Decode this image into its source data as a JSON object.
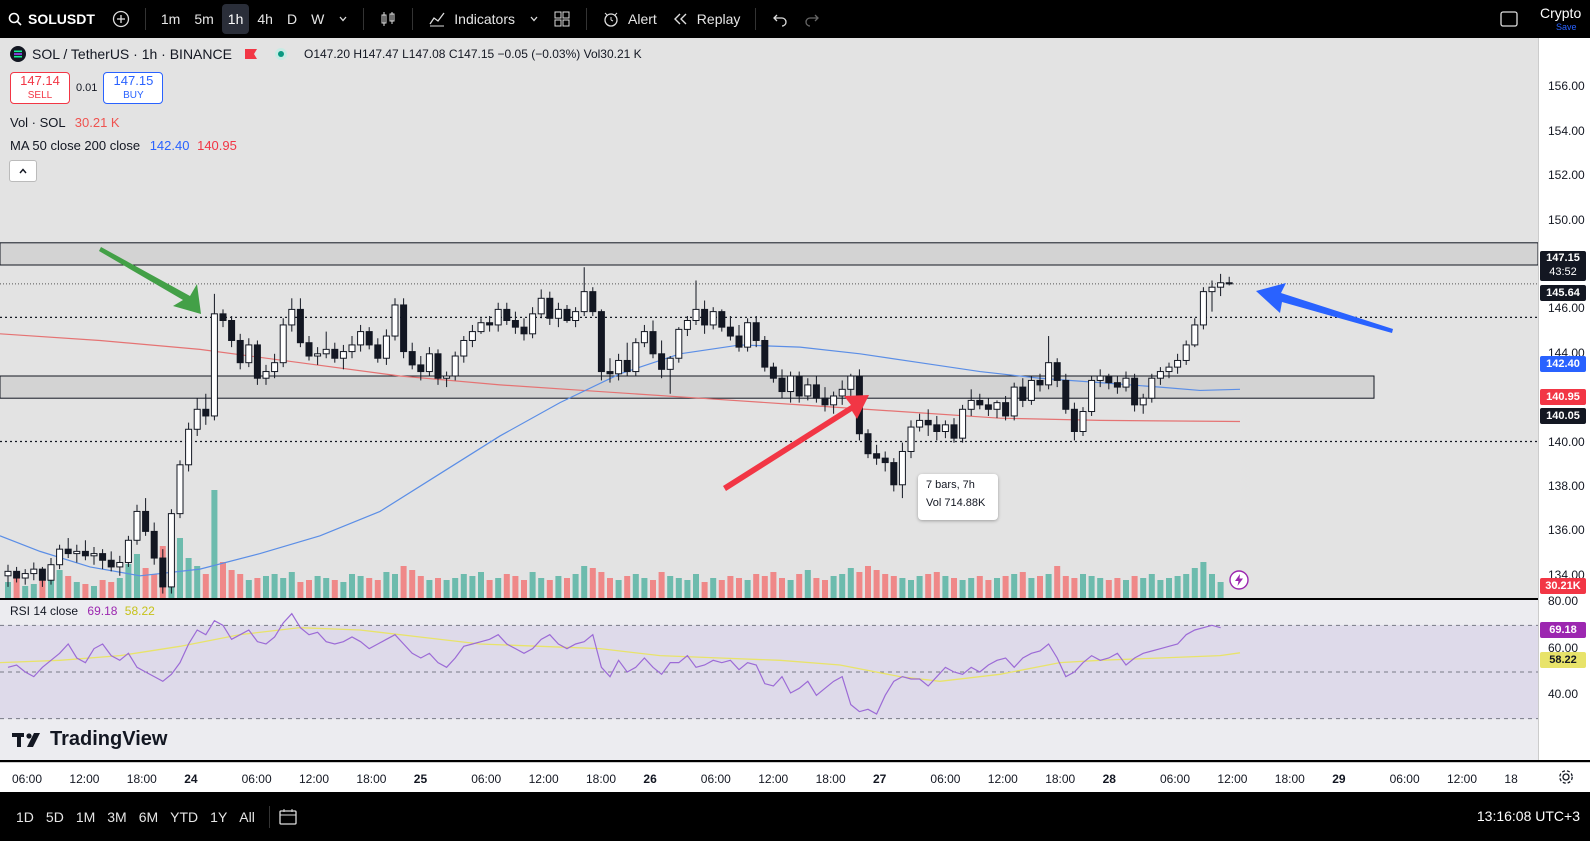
{
  "toolbar": {
    "symbol": "SOLUSDT",
    "intervals": [
      "1m",
      "5m",
      "1h",
      "4h",
      "D",
      "W"
    ],
    "active_interval": "1h",
    "indicators_label": "Indicators",
    "alert_label": "Alert",
    "replay_label": "Replay",
    "crypto_label": "Crypto",
    "save_label": "Save"
  },
  "legend": {
    "title": "SOL / TetherUS · 1h · BINANCE",
    "o_label": "O",
    "o": "147.20",
    "h_label": "H",
    "h": "147.47",
    "l_label": "L",
    "l": "147.08",
    "c_label": "C",
    "c": "147.15",
    "change": "−0.05 (−0.03%)",
    "vol_label": "Vol",
    "vol": "30.21 K"
  },
  "trade": {
    "sell_price": "147.14",
    "sell_label": "SELL",
    "spread": "0.01",
    "buy_price": "147.15",
    "buy_label": "BUY"
  },
  "indicators": {
    "vol_label": "Vol · SOL",
    "vol_value": "30.21 K",
    "ma_label": "MA 50 close 200 close",
    "ma50_value": "142.40",
    "ma200_value": "140.95",
    "collapse_icon": "chevron-up-icon"
  },
  "rsi": {
    "label": "RSI 14 close",
    "value": "69.18",
    "ma_value": "58.22"
  },
  "tooltip": {
    "line1": "7 bars, 7h",
    "line2": "Vol 714.88K"
  },
  "logo": "TradingView",
  "price_tags": {
    "last": "147.15",
    "countdown": "43:52",
    "level1": "145.64",
    "ma50": "142.40",
    "ma200": "140.95",
    "level2": "140.05",
    "volume": "30.21K",
    "rsi": "69.18",
    "rsi_ma": "58.22"
  },
  "bottombar": {
    "ranges": [
      "1D",
      "5D",
      "1M",
      "3M",
      "6M",
      "YTD",
      "1Y",
      "All"
    ],
    "clock": "13:16:08 UTC+3"
  },
  "colors": {
    "up": "#ffffff",
    "down": "#131722",
    "ma50": "#5b8ee6",
    "ma200": "#e57373",
    "rsi": "#9c6bd6",
    "rsi_ma": "#e8e36a",
    "vol_up": "#5fb6a6",
    "vol_down": "#ef7d7d"
  },
  "chart_data": {
    "type": "candlestick",
    "price_axis": {
      "min": 133,
      "max": 157,
      "ticks": [
        "156.00",
        "154.00",
        "152.00",
        "150.00",
        "148.00",
        "146.00",
        "144.00",
        "142.00",
        "140.00",
        "138.00",
        "136.00",
        "134.00"
      ]
    },
    "rsi_axis": {
      "min": 20,
      "max": 80,
      "ticks": [
        "80.00",
        "60.00",
        "40.00"
      ]
    },
    "x_labels": [
      "06:00",
      "12:00",
      "18:00",
      "24",
      "06:00",
      "12:00",
      "18:00",
      "25",
      "06:00",
      "12:00",
      "18:00",
      "26",
      "06:00",
      "12:00",
      "18:00",
      "27",
      "06:00",
      "12:00",
      "18:00",
      "28",
      "06:00",
      "12:00",
      "18:00",
      "29",
      "06:00",
      "12:00",
      "18"
    ],
    "day_labels": [
      "24",
      "25",
      "26",
      "27",
      "28",
      "29"
    ],
    "candles_ohlc": [
      [
        134.0,
        134.5,
        133.5,
        134.2
      ],
      [
        134.2,
        134.4,
        133.7,
        133.9
      ],
      [
        133.9,
        134.3,
        133.6,
        134.1
      ],
      [
        134.1,
        134.6,
        133.8,
        134.3
      ],
      [
        134.3,
        134.4,
        133.5,
        133.8
      ],
      [
        133.8,
        134.8,
        133.6,
        134.5
      ],
      [
        134.5,
        135.4,
        134.3,
        135.2
      ],
      [
        135.2,
        135.7,
        134.8,
        135.0
      ],
      [
        135.0,
        135.4,
        134.6,
        135.1
      ],
      [
        135.1,
        135.6,
        134.7,
        134.9
      ],
      [
        134.9,
        135.3,
        134.5,
        135.0
      ],
      [
        135.0,
        135.2,
        134.3,
        134.7
      ],
      [
        134.7,
        135.1,
        134.2,
        134.4
      ],
      [
        134.4,
        134.9,
        134.0,
        134.6
      ],
      [
        134.6,
        135.8,
        134.4,
        135.6
      ],
      [
        135.6,
        137.2,
        135.4,
        136.9
      ],
      [
        136.9,
        137.5,
        135.8,
        136.0
      ],
      [
        136.0,
        136.4,
        134.5,
        134.8
      ],
      [
        134.8,
        135.2,
        133.2,
        133.5
      ],
      [
        133.5,
        137.0,
        133.2,
        136.8
      ],
      [
        136.8,
        139.2,
        136.6,
        139.0
      ],
      [
        139.0,
        140.9,
        138.7,
        140.6
      ],
      [
        140.6,
        142.0,
        140.3,
        141.5
      ],
      [
        141.5,
        142.2,
        140.8,
        141.2
      ],
      [
        141.2,
        146.7,
        141.0,
        145.8
      ],
      [
        145.8,
        146.0,
        145.2,
        145.5
      ],
      [
        145.5,
        145.7,
        144.3,
        144.6
      ],
      [
        144.6,
        144.9,
        143.3,
        143.6
      ],
      [
        143.6,
        144.7,
        143.4,
        144.4
      ],
      [
        144.4,
        144.6,
        142.6,
        142.9
      ],
      [
        142.9,
        143.5,
        142.6,
        143.2
      ],
      [
        143.2,
        144.0,
        142.9,
        143.6
      ],
      [
        143.6,
        145.6,
        143.4,
        145.3
      ],
      [
        145.3,
        146.5,
        145.0,
        146.0
      ],
      [
        146.0,
        146.5,
        144.3,
        144.5
      ],
      [
        144.5,
        144.8,
        143.7,
        143.9
      ],
      [
        143.9,
        144.3,
        143.5,
        144.0
      ],
      [
        144.0,
        145.0,
        143.8,
        144.2
      ],
      [
        144.2,
        144.5,
        143.6,
        143.8
      ],
      [
        143.8,
        144.4,
        143.3,
        144.1
      ],
      [
        144.1,
        144.8,
        143.8,
        144.4
      ],
      [
        144.4,
        145.3,
        144.1,
        145.0
      ],
      [
        145.0,
        145.2,
        144.2,
        144.4
      ],
      [
        144.4,
        144.7,
        143.6,
        143.8
      ],
      [
        143.8,
        145.1,
        143.5,
        144.8
      ],
      [
        144.8,
        146.5,
        144.6,
        146.2
      ],
      [
        146.2,
        146.5,
        143.8,
        144.1
      ],
      [
        144.1,
        144.5,
        143.3,
        143.5
      ],
      [
        143.5,
        143.9,
        142.8,
        143.2
      ],
      [
        143.2,
        144.3,
        143.0,
        144.0
      ],
      [
        144.0,
        144.2,
        142.6,
        142.9
      ],
      [
        142.9,
        143.2,
        142.5,
        143.0
      ],
      [
        143.0,
        144.1,
        142.8,
        143.9
      ],
      [
        143.9,
        144.8,
        143.6,
        144.6
      ],
      [
        144.6,
        145.3,
        144.3,
        145.0
      ],
      [
        145.0,
        145.6,
        144.9,
        145.4
      ],
      [
        145.4,
        145.7,
        145.0,
        145.3
      ],
      [
        145.3,
        146.3,
        145.0,
        146.0
      ],
      [
        146.0,
        146.3,
        145.3,
        145.5
      ],
      [
        145.5,
        145.9,
        144.9,
        145.2
      ],
      [
        145.2,
        145.6,
        144.6,
        144.9
      ],
      [
        144.9,
        146.1,
        144.7,
        145.8
      ],
      [
        145.8,
        146.9,
        145.6,
        146.5
      ],
      [
        146.5,
        146.8,
        145.3,
        145.6
      ],
      [
        145.6,
        146.3,
        145.2,
        146.0
      ],
      [
        146.0,
        146.2,
        145.4,
        145.5
      ],
      [
        145.5,
        146.1,
        145.2,
        145.9
      ],
      [
        145.9,
        147.9,
        145.7,
        146.8
      ],
      [
        146.8,
        147.0,
        145.7,
        145.9
      ],
      [
        145.9,
        146.0,
        142.8,
        143.2
      ],
      [
        143.2,
        143.8,
        142.7,
        143.1
      ],
      [
        143.1,
        144.0,
        142.8,
        143.7
      ],
      [
        143.7,
        144.5,
        143.0,
        143.2
      ],
      [
        143.2,
        144.7,
        143.0,
        144.5
      ],
      [
        144.5,
        145.3,
        144.3,
        145.0
      ],
      [
        145.0,
        145.5,
        143.8,
        144.0
      ],
      [
        144.0,
        144.6,
        142.9,
        143.3
      ],
      [
        143.3,
        143.9,
        142.2,
        143.8
      ],
      [
        143.8,
        145.2,
        143.6,
        145.1
      ],
      [
        145.1,
        145.7,
        144.8,
        145.5
      ],
      [
        145.5,
        147.3,
        145.3,
        146.0
      ],
      [
        146.0,
        146.4,
        144.9,
        145.3
      ],
      [
        145.3,
        146.1,
        145.1,
        145.9
      ],
      [
        145.9,
        146.0,
        145.0,
        145.2
      ],
      [
        145.2,
        145.7,
        144.6,
        144.8
      ],
      [
        144.8,
        145.3,
        144.1,
        144.3
      ],
      [
        144.3,
        145.6,
        144.1,
        145.4
      ],
      [
        145.4,
        145.7,
        144.3,
        144.6
      ],
      [
        144.6,
        144.8,
        143.2,
        143.4
      ],
      [
        143.4,
        143.6,
        142.7,
        142.9
      ],
      [
        142.9,
        143.3,
        142.0,
        142.3
      ],
      [
        142.3,
        143.2,
        141.8,
        143.0
      ],
      [
        143.0,
        143.2,
        141.8,
        142.1
      ],
      [
        142.1,
        142.9,
        141.9,
        142.6
      ],
      [
        142.6,
        143.0,
        141.8,
        142.0
      ],
      [
        142.0,
        142.5,
        141.4,
        141.7
      ],
      [
        141.7,
        142.3,
        141.3,
        142.1
      ],
      [
        142.1,
        142.8,
        141.7,
        142.4
      ],
      [
        142.4,
        143.1,
        141.9,
        143.0
      ],
      [
        143.0,
        143.3,
        140.1,
        140.4
      ],
      [
        140.4,
        140.6,
        139.3,
        139.5
      ],
      [
        139.5,
        139.9,
        139.0,
        139.3
      ],
      [
        139.3,
        139.6,
        138.7,
        139.1
      ],
      [
        139.1,
        139.3,
        137.8,
        138.1
      ],
      [
        138.1,
        140.0,
        137.5,
        139.6
      ],
      [
        139.6,
        141.0,
        139.3,
        140.7
      ],
      [
        140.7,
        141.3,
        140.5,
        141.0
      ],
      [
        141.0,
        141.5,
        140.3,
        140.8
      ],
      [
        140.8,
        141.2,
        140.1,
        140.5
      ],
      [
        140.5,
        141.0,
        140.2,
        140.8
      ],
      [
        140.8,
        141.1,
        140.0,
        140.2
      ],
      [
        140.2,
        141.7,
        140.0,
        141.5
      ],
      [
        141.5,
        142.4,
        141.2,
        141.9
      ],
      [
        141.9,
        142.2,
        141.5,
        141.7
      ],
      [
        141.7,
        142.0,
        141.2,
        141.5
      ],
      [
        141.5,
        141.9,
        141.1,
        141.8
      ],
      [
        141.8,
        142.1,
        141.0,
        141.2
      ],
      [
        141.2,
        142.7,
        141.0,
        142.5
      ],
      [
        142.5,
        142.9,
        141.6,
        141.9
      ],
      [
        141.9,
        143.0,
        141.7,
        142.8
      ],
      [
        142.8,
        143.1,
        142.3,
        142.6
      ],
      [
        142.6,
        144.8,
        142.4,
        143.6
      ],
      [
        143.6,
        143.8,
        142.5,
        142.8
      ],
      [
        142.8,
        143.1,
        141.3,
        141.5
      ],
      [
        141.5,
        141.8,
        140.1,
        140.5
      ],
      [
        140.5,
        141.6,
        140.3,
        141.4
      ],
      [
        141.4,
        143.0,
        141.2,
        142.8
      ],
      [
        142.8,
        143.3,
        142.5,
        143.0
      ],
      [
        143.0,
        143.1,
        142.4,
        142.7
      ],
      [
        142.7,
        143.0,
        142.2,
        142.5
      ],
      [
        142.5,
        143.2,
        142.3,
        142.9
      ],
      [
        142.9,
        143.1,
        141.4,
        141.7
      ],
      [
        141.7,
        142.2,
        141.3,
        142.0
      ],
      [
        142.0,
        143.1,
        141.8,
        142.9
      ],
      [
        142.9,
        143.4,
        142.6,
        143.2
      ],
      [
        143.2,
        143.6,
        142.9,
        143.4
      ],
      [
        143.4,
        144.0,
        143.1,
        143.7
      ],
      [
        143.7,
        144.6,
        143.5,
        144.4
      ],
      [
        144.4,
        145.6,
        144.3,
        145.3
      ],
      [
        145.3,
        147.0,
        145.1,
        146.8
      ],
      [
        146.8,
        147.3,
        145.9,
        147.0
      ],
      [
        147.0,
        147.6,
        146.6,
        147.2
      ],
      [
        147.2,
        147.47,
        147.08,
        147.15
      ]
    ],
    "volume": [
      8,
      10,
      6,
      7,
      9,
      12,
      14,
      11,
      8,
      7,
      6,
      9,
      8,
      10,
      17,
      22,
      15,
      12,
      26,
      24,
      30,
      20,
      16,
      12,
      54,
      18,
      14,
      12,
      9,
      10,
      11,
      12,
      10,
      13,
      8,
      9,
      11,
      10,
      9,
      8,
      12,
      11,
      10,
      9,
      13,
      12,
      16,
      14,
      11,
      9,
      10,
      9,
      10,
      12,
      11,
      13,
      9,
      10,
      12,
      11,
      9,
      13,
      10,
      9,
      11,
      10,
      12,
      16,
      15,
      13,
      10,
      9,
      11,
      12,
      10,
      9,
      13,
      11,
      10,
      9,
      12,
      8,
      10,
      9,
      11,
      10,
      9,
      12,
      11,
      13,
      10,
      9,
      12,
      14,
      10,
      9,
      11,
      12,
      15,
      13,
      16,
      14,
      12,
      11,
      10,
      9,
      11,
      12,
      13,
      11,
      10,
      9,
      10,
      11,
      9,
      10,
      11,
      12,
      13,
      10,
      11,
      12,
      16,
      11,
      10,
      12,
      11,
      10,
      9,
      10,
      9,
      11,
      10,
      12,
      9,
      10,
      11,
      12,
      15,
      18,
      12,
      8
    ],
    "ma50": [
      [
        0,
        135.8
      ],
      [
        40,
        135.1
      ],
      [
        90,
        134.4
      ],
      [
        140,
        134.0
      ],
      [
        200,
        134.3
      ],
      [
        260,
        135.0
      ],
      [
        320,
        135.8
      ],
      [
        380,
        136.9
      ],
      [
        440,
        138.6
      ],
      [
        500,
        140.3
      ],
      [
        560,
        141.8
      ],
      [
        620,
        143.1
      ],
      [
        680,
        144.0
      ],
      [
        740,
        144.4
      ],
      [
        800,
        144.3
      ],
      [
        860,
        144.0
      ],
      [
        920,
        143.6
      ],
      [
        980,
        143.2
      ],
      [
        1040,
        142.9
      ],
      [
        1100,
        142.7
      ],
      [
        1160,
        142.5
      ],
      [
        1200,
        142.35
      ],
      [
        1240,
        142.4
      ]
    ],
    "ma200": [
      [
        0,
        144.9
      ],
      [
        100,
        144.6
      ],
      [
        200,
        144.2
      ],
      [
        300,
        143.6
      ],
      [
        400,
        143.0
      ],
      [
        500,
        142.6
      ],
      [
        600,
        142.3
      ],
      [
        700,
        142.0
      ],
      [
        800,
        141.7
      ],
      [
        900,
        141.4
      ],
      [
        1000,
        141.1
      ],
      [
        1100,
        141.0
      ],
      [
        1240,
        140.95
      ]
    ],
    "rsi_values": [
      52,
      53,
      50,
      48,
      52,
      55,
      58,
      62,
      56,
      54,
      60,
      62,
      57,
      55,
      58,
      52,
      50,
      48,
      46,
      49,
      54,
      62,
      68,
      66,
      72,
      70,
      64,
      66,
      68,
      63,
      62,
      65,
      71,
      75,
      69,
      66,
      67,
      63,
      62,
      63,
      65,
      63,
      60,
      62,
      64,
      66,
      62,
      58,
      56,
      58,
      54,
      52,
      56,
      61,
      62,
      63,
      64,
      66,
      62,
      60,
      58,
      60,
      64,
      66,
      62,
      60,
      62,
      63,
      66,
      52,
      48,
      55,
      50,
      52,
      56,
      52,
      49,
      54,
      54,
      57,
      52,
      53,
      55,
      54,
      55,
      51,
      54,
      53,
      45,
      44,
      48,
      41,
      43,
      46,
      40,
      43,
      46,
      48,
      36,
      33,
      34,
      32,
      40,
      46,
      48,
      47,
      47,
      44,
      48,
      52,
      50,
      49,
      52,
      50,
      53,
      55,
      56,
      52,
      56,
      58,
      59,
      62,
      56,
      48,
      50,
      54,
      57,
      55,
      56,
      58,
      53,
      56,
      58,
      59,
      60,
      61,
      62,
      66,
      68,
      69,
      70,
      69
    ],
    "rsi_ma": [
      [
        0,
        54
      ],
      [
        60,
        55
      ],
      [
        120,
        57
      ],
      [
        180,
        61
      ],
      [
        240,
        66
      ],
      [
        300,
        69
      ],
      [
        360,
        68
      ],
      [
        420,
        65
      ],
      [
        480,
        62
      ],
      [
        540,
        61
      ],
      [
        600,
        60
      ],
      [
        660,
        57
      ],
      [
        720,
        56
      ],
      [
        780,
        55
      ],
      [
        840,
        53
      ],
      [
        900,
        48
      ],
      [
        940,
        46
      ],
      [
        1000,
        49
      ],
      [
        1060,
        54
      ],
      [
        1100,
        55
      ],
      [
        1160,
        56
      ],
      [
        1220,
        57
      ],
      [
        1240,
        58.22
      ]
    ],
    "levels": [
      145.64,
      140.05
    ],
    "zones": [
      [
        148.0,
        149.0
      ],
      [
        142.0,
        143.0
      ]
    ],
    "measure": {
      "bars": 7,
      "hours": 7,
      "volume": "714.88K"
    }
  }
}
